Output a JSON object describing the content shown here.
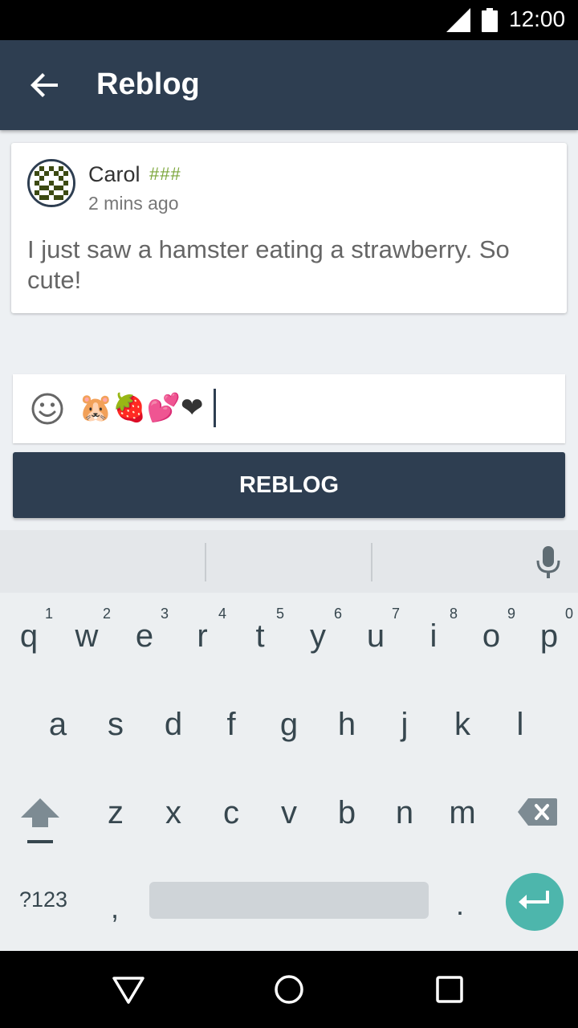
{
  "status_bar": {
    "time": "12:00",
    "icons": [
      "signal-icon",
      "battery-icon"
    ]
  },
  "app_bar": {
    "title": "Reblog",
    "back_icon": "arrow-back-icon"
  },
  "post": {
    "author": "Carol",
    "tags": "###",
    "timestamp": "2 mins ago",
    "text": "I just saw a hamster eating a strawberry. So cute!"
  },
  "comment": {
    "value": "🐹🍓💕❤",
    "emoji_icon": "smiley-icon"
  },
  "reblog_button": {
    "label": "REBLOG"
  },
  "keyboard": {
    "row1": [
      {
        "char": "q",
        "hint": "1"
      },
      {
        "char": "w",
        "hint": "2"
      },
      {
        "char": "e",
        "hint": "3"
      },
      {
        "char": "r",
        "hint": "4"
      },
      {
        "char": "t",
        "hint": "5"
      },
      {
        "char": "y",
        "hint": "6"
      },
      {
        "char": "u",
        "hint": "7"
      },
      {
        "char": "i",
        "hint": "8"
      },
      {
        "char": "o",
        "hint": "9"
      },
      {
        "char": "p",
        "hint": "0"
      }
    ],
    "row2": [
      "a",
      "s",
      "d",
      "f",
      "g",
      "h",
      "j",
      "k",
      "l"
    ],
    "row3": [
      "z",
      "x",
      "c",
      "v",
      "b",
      "n",
      "m"
    ],
    "symbols_label": "?123",
    "comma": ",",
    "period": ".",
    "accent_color": "#4db6ac"
  },
  "colors": {
    "primary": "#2e3e51",
    "tag_green": "#7ba63a"
  }
}
